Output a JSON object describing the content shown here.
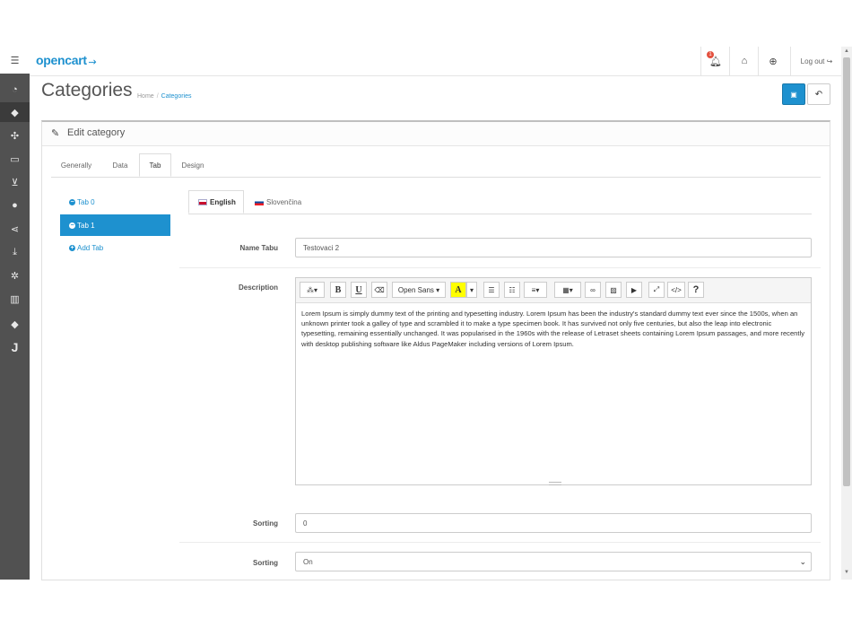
{
  "brand": {
    "name": "opencart"
  },
  "header": {
    "notification_count": "1",
    "logout_label": "Log out"
  },
  "sidebar": {
    "icons": [
      "menu-toggle-icon",
      "dashboard-icon",
      "tags-icon",
      "puzzle-icon",
      "desktop-icon",
      "cart-icon",
      "user-icon",
      "share-icon",
      "download-icon",
      "gear-icon",
      "bar-chart-icon",
      "tag-icon",
      "j-icon"
    ]
  },
  "page": {
    "title": "Categories",
    "breadcrumb": [
      "Home",
      "Categories"
    ],
    "panel_title": "Edit category"
  },
  "tabs": [
    "Generally",
    "Data",
    "Tab",
    "Design"
  ],
  "active_tab": "Tab",
  "vertical_tabs": {
    "items": [
      "Tab 0",
      "Tab 1"
    ],
    "add_label": "Add Tab",
    "active": "Tab 1"
  },
  "languages": [
    "English",
    "Slovenčina"
  ],
  "active_language": "English",
  "form": {
    "name_label": "Name Tabu",
    "name_value": "Testovaci 2",
    "description_label": "Description",
    "sorting_label": "Sorting",
    "sorting_value": "0",
    "status_label": "Sorting",
    "status_value": "On"
  },
  "editor": {
    "font_name": "Open Sans",
    "text": "Lorem Ipsum is simply dummy text of the printing and typesetting industry. Lorem Ipsum has been the industry's standard dummy text ever since the 1500s, when an unknown printer took a galley of type and scrambled it to make a type specimen book. It has survived not only five centuries, but also the leap into electronic typesetting, remaining essentially unchanged. It was popularised in the 1960s with the release of Letraset sheets containing Lorem Ipsum passages, and more recently with desktop publishing software like Aldus PageMaker including versions of Lorem Ipsum."
  },
  "colors": {
    "primary": "#1e91cf",
    "sidebar": "#515151"
  }
}
